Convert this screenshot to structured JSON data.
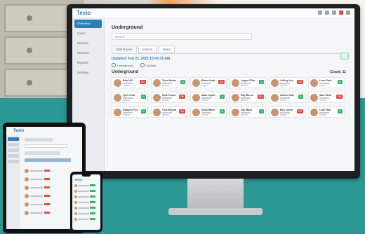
{
  "app": {
    "logo": "Tesio"
  },
  "sidebar": {
    "items": [
      "Overview",
      "Users",
      "Devices",
      "Sensors",
      "Reports",
      "Settings"
    ]
  },
  "main": {
    "title": "Underground",
    "search_placeholder": "Search",
    "tabs": [
      "Staff Roster",
      "Visitors",
      "Alerts"
    ],
    "updated": "Updated: Feb 22, 2021 10:43:35 AM",
    "toggles": [
      "Underground",
      "Surface"
    ],
    "section": "Underground",
    "count": "Count: 11"
  },
  "cards": [
    {
      "name": "Bob Hill",
      "status": "Out",
      "color": "red"
    },
    {
      "name": "Tyler Morris",
      "status": "In",
      "color": "green"
    },
    {
      "name": "Bruce Hunt",
      "status": "Out",
      "color": "red"
    },
    {
      "name": "Logan Tiller",
      "status": "In",
      "color": "green"
    },
    {
      "name": "Jeffrey Lee",
      "status": "Out",
      "color": "red"
    },
    {
      "name": "Leon Park",
      "status": "In",
      "color": "green"
    },
    {
      "name": "Tyler Ford",
      "status": "In",
      "color": "green"
    },
    {
      "name": "Rick Turner",
      "status": "Out",
      "color": "red"
    },
    {
      "name": "Mark Taylor",
      "status": "In",
      "color": "green"
    },
    {
      "name": "Ray Burns",
      "status": "Out",
      "color": "red"
    },
    {
      "name": "Arthur Gale",
      "status": "In",
      "color": "green"
    },
    {
      "name": "Sam West",
      "status": "Out",
      "color": "red"
    },
    {
      "name": "Dwayne Fox",
      "status": "In",
      "color": "green"
    },
    {
      "name": "Cole Bryant",
      "status": "Out",
      "color": "red"
    },
    {
      "name": "Dean Ward",
      "status": "In",
      "color": "green"
    },
    {
      "name": "Jim Mack",
      "status": "In",
      "color": "green"
    },
    {
      "name": "Ben Carter",
      "status": "Out",
      "color": "red"
    },
    {
      "name": "Luke Hart",
      "status": "In",
      "color": "green"
    }
  ]
}
